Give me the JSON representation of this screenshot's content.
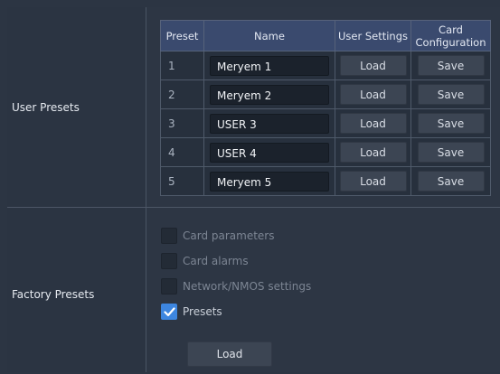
{
  "sections": {
    "user_presets_label": "User Presets",
    "factory_presets_label": "Factory Presets"
  },
  "table": {
    "headers": {
      "preset": "Preset",
      "name": "Name",
      "user_settings": "User Settings",
      "card_configuration_line1": "Card",
      "card_configuration_line2": "Configuration"
    },
    "rows": [
      {
        "num": "1",
        "name": "Meryem 1",
        "load": "Load",
        "save": "Save"
      },
      {
        "num": "2",
        "name": "Meryem 2",
        "load": "Load",
        "save": "Save"
      },
      {
        "num": "3",
        "name": "USER 3",
        "load": "Load",
        "save": "Save"
      },
      {
        "num": "4",
        "name": "USER 4",
        "load": "Load",
        "save": "Save"
      },
      {
        "num": "5",
        "name": "Meryem 5",
        "load": "Load",
        "save": "Save"
      }
    ]
  },
  "factory": {
    "options": [
      {
        "label": "Card parameters",
        "checked": false
      },
      {
        "label": "Card alarms",
        "checked": false
      },
      {
        "label": "Network/NMOS settings",
        "checked": false
      },
      {
        "label": "Presets",
        "checked": true
      }
    ],
    "load_label": "Load"
  },
  "colors": {
    "header_bg": "#3a4a6e",
    "checkbox_checked": "#3d86e0",
    "background": "#2c3543"
  }
}
